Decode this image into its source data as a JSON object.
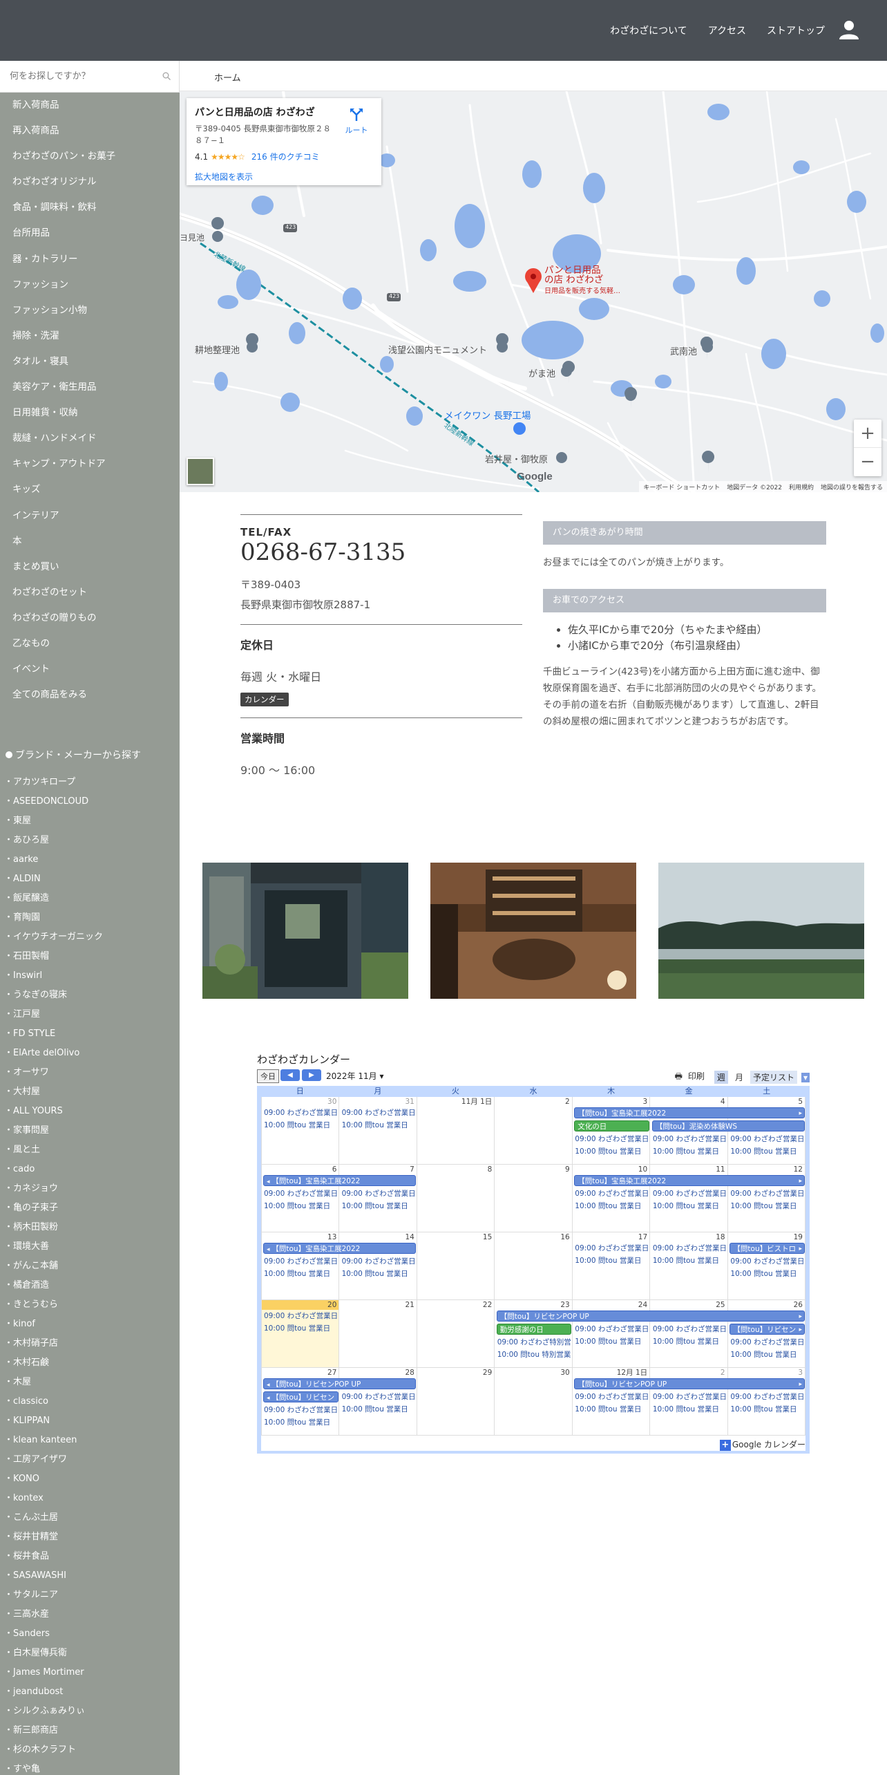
{
  "header": {
    "nav": [
      "わざわざについて",
      "アクセス",
      "ストアトップ"
    ]
  },
  "search": {
    "placeholder": "何をお探しですか？"
  },
  "sidebar": {
    "categories": [
      "新入荷商品",
      "再入荷商品",
      "わざわざのパン・お菓子",
      "わざわざオリジナル",
      "食品・調味料・飲料",
      "台所用品",
      "器・カトラリー",
      "ファッション",
      "ファッション小物",
      "掃除・洗濯",
      "タオル・寝具",
      "美容ケア・衛生用品",
      "日用雑貨・収納",
      "裁縫・ハンドメイド",
      "キャンプ・アウトドア",
      "キッズ",
      "インテリア",
      "本",
      "まとめ買い",
      "わざわざのセット",
      "わざわざの贈りもの",
      "乙なもの",
      "イベント",
      "全ての商品をみる"
    ],
    "brand_heading": "ブランド・メーカーから探す",
    "brands": [
      "アカツキロープ",
      "ASEEDONCLOUD",
      "東屋",
      "あひろ屋",
      "aarke",
      "ALDIN",
      "飯尾醸造",
      "育陶園",
      "イケウチオーガニック",
      "石田製帽",
      "Inswirl",
      "うなぎの寝床",
      "江戸屋",
      "FD STYLE",
      "ElArte delOlivo",
      "オーサワ",
      "大村屋",
      "ALL YOURS",
      "家事問屋",
      "風と土",
      "cado",
      "カネジョウ",
      "亀の子束子",
      "柄木田製粉",
      "環境大善",
      "がんこ本舗",
      "橘倉酒造",
      "きとうむら",
      "kinof",
      "木村硝子店",
      "木村石鹸",
      "木屋",
      "classico",
      "KLIPPAN",
      "klean kanteen",
      "工房アイザワ",
      "KONO",
      "kontex",
      "こんぶ土居",
      "桜井甘精堂",
      "桜井食品",
      "SASAWASHI",
      "サタルニア",
      "三高水産",
      "Sanders",
      "白木屋傳兵衛",
      "James Mortimer",
      "jeandubost",
      "シルクふぁみりぃ",
      "新三郎商店",
      "杉の木クラフト",
      "すや亀"
    ]
  },
  "breadcrumb": {
    "home": "ホーム"
  },
  "map": {
    "place_name": "パンと日用品の店 わざわざ",
    "address": "〒389-0405 長野県東御市御牧原２８８７−１",
    "rating": "4.1",
    "stars": "★★★★☆",
    "reviews": "216 件のクチコミ",
    "enlarge": "拡大地図を表示",
    "route": "ルート",
    "pin_label_1": "パンと日用品",
    "pin_label_2": "の店 わざわざ",
    "pin_sub": "日用品を販売する気軽…",
    "labels": {
      "park": "浅望公園内モニュメント",
      "gama": "がま池",
      "bukan": "武南池",
      "tenchi": "耕地整理池",
      "main": "メイクワン 長野工場",
      "iwai": "岩井屋・御牧原",
      "ike": "ヨ見池",
      "railway": "北陸新幹線",
      "road1": "423",
      "road2": "423"
    },
    "zoom_in": "+",
    "zoom_out": "−",
    "footer": [
      "キーボード ショートカット",
      "地図データ ©2022",
      "利用規約",
      "地図の誤りを報告する"
    ],
    "google": "Google"
  },
  "info": {
    "tel_label": "TEL/FAX",
    "tel": "0268-67-3135",
    "postal": "〒389-0403",
    "address": "長野県東御市御牧原2887-1",
    "closed_title": "定休日",
    "closed_text": "毎週 火・水曜日",
    "calendar_tag": "カレンダー",
    "hours_title": "営業時間",
    "hours_text": "9:00 ～ 16:00",
    "bread_head": "パンの焼きあがり時間",
    "bread_text": "お昼までには全てのパンが焼き上がります。",
    "car_head": "お車でのアクセス",
    "car_list": [
      "佐久平ICから車で20分（ちゃたまや経由）",
      "小諸ICから車で20分（布引温泉経由）"
    ],
    "car_desc": "千曲ビューライン(423号)を小諸方面から上田方面に進む途中、御牧原保育園を過ぎ、右手に北部消防団の火の見やぐらがあります。その手前の道を右折（自動販売機があります）して直進し、2軒目の斜め屋根の畑に囲まれてポツンと建つおうちがお店です。"
  },
  "calendar": {
    "title": "わざわざカレンダー",
    "today": "今日",
    "prev": "◀",
    "next": "▶",
    "month": "2022年 11月",
    "print": "印刷",
    "views": [
      "週",
      "月",
      "予定リスト"
    ],
    "dow": [
      "日",
      "月",
      "火",
      "水",
      "木",
      "金",
      "土"
    ],
    "weeks": [
      [
        "30",
        "31",
        "11月 1日",
        "2",
        "3",
        "4",
        "5"
      ],
      [
        "6",
        "7",
        "8",
        "9",
        "10",
        "11",
        "12"
      ],
      [
        "13",
        "14",
        "15",
        "16",
        "17",
        "18",
        "19"
      ],
      [
        "20",
        "21",
        "22",
        "23",
        "24",
        "25",
        "26"
      ],
      [
        "27",
        "28",
        "29",
        "30",
        "12月 1日",
        "2",
        "3"
      ]
    ],
    "ev_wazawaza": "09:00 わざわざ営業日",
    "ev_tou": "10:00 問tou 営業日",
    "ev_somekoubou": "【問tou】宝島染工展2022",
    "ev_bunka": "文化の日",
    "ev_doro": "【問tou】泥染め体験WS",
    "ev_rebisen": "【問tou】リビセンPOP UP",
    "ev_rebisen_short": "【問tou】リビセン",
    "ev_bistro": "【問tou】ビストロ",
    "ev_kinro": "勤労感謝の日",
    "ev_tokubetsu1": "09:00 わざわざ特別営",
    "ev_tokubetsu2": "10:00 問tou 特別営業",
    "footer": "Google カレンダー",
    "plus": "+"
  },
  "colors": {
    "header": "#4a4f55",
    "sidebar": "#959b94",
    "cal_blue": "#668cd9",
    "cal_green": "#4cb052"
  }
}
